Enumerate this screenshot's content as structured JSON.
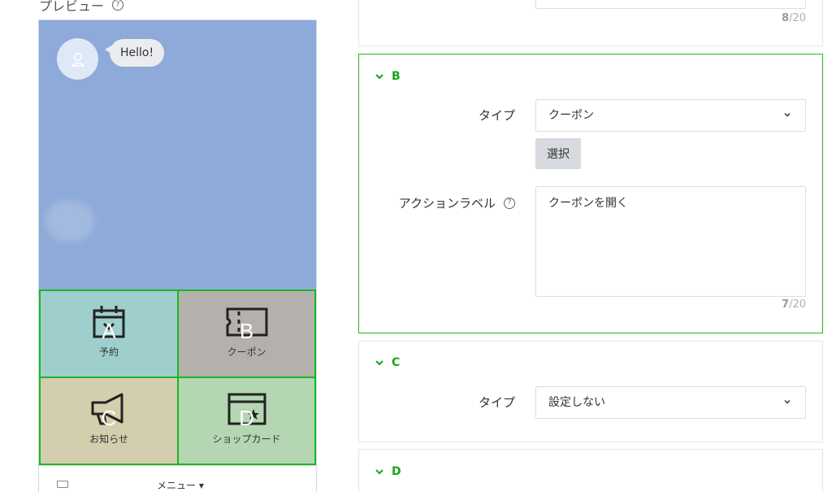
{
  "preview": {
    "title": "プレビュー",
    "help_icon": "question-circle-icon",
    "bubble_text": "Hello!",
    "avatar_icon": "user-icon",
    "menu_bar_label": "メニュー ▾",
    "keyboard_icon": "keyboard-icon",
    "cells": [
      {
        "letter": "A",
        "label": "予約",
        "icon": "calendar-icon",
        "color": "#9fcfcd"
      },
      {
        "letter": "B",
        "label": "クーポン",
        "icon": "coupon-icon",
        "color": "#b4b1ac"
      },
      {
        "letter": "C",
        "label": "お知らせ",
        "icon": "megaphone-icon",
        "color": "#d3cfae"
      },
      {
        "letter": "D",
        "label": "ショップカード",
        "icon": "shop-card-icon",
        "color": "#b5d6b3"
      }
    ]
  },
  "panels": {
    "top": {
      "counter_value": "8",
      "counter_max": "/20"
    },
    "b": {
      "section": "B",
      "type_label": "タイプ",
      "type_value": "クーポン",
      "select_button": "選択",
      "action_label": "アクションラベル",
      "action_value": "クーポンを開く",
      "counter_value": "7",
      "counter_max": "/20"
    },
    "c": {
      "section": "C",
      "type_label": "タイプ",
      "type_value": "設定しない"
    },
    "d": {
      "section": "D"
    }
  },
  "colors": {
    "accent_green": "#17a51a",
    "active_border": "#2bb51b",
    "chat_bg": "#8eaad9"
  }
}
